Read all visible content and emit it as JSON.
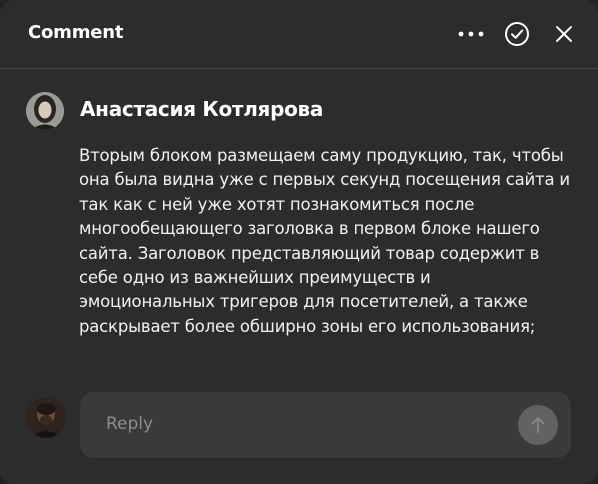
{
  "header": {
    "title": "Comment",
    "icons": {
      "more": "more-dots-icon",
      "resolve": "check-circle-icon",
      "close": "close-icon"
    }
  },
  "comment": {
    "author": "Анастасия Котлярова",
    "text": "Вторым блоком размещаем саму продукцию, так, чтобы она была видна уже с первых секунд посещения сайта и так как с ней уже хотят познакомиться после многообещающего заголовка в первом блоке нашего сайта. Заголовок представляющий товар содержит в себе одно из важнейших преимуществ и эмоциональных тригеров для посетителей, а также раскрывает более обширно зоны его использования;"
  },
  "reply": {
    "placeholder": "Reply",
    "value": "",
    "send_icon": "arrow-up-icon"
  },
  "colors": {
    "panel_background": "#2c2c2c",
    "reply_background": "#3a3a3a",
    "send_button": "#626262",
    "text_primary": "#ffffff",
    "placeholder": "#8d8d8d"
  }
}
